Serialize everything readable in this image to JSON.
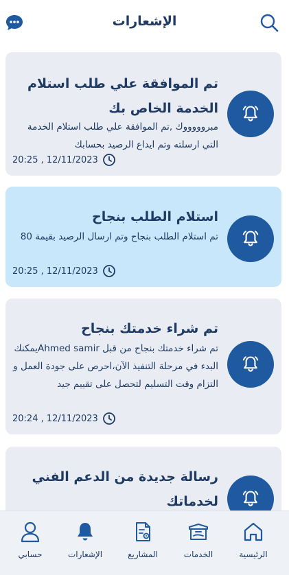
{
  "header": {
    "title": "الإشعارات",
    "search_icon": "search-icon",
    "chat_icon": "chat-icon"
  },
  "notifications": [
    {
      "title": "تم الموافقة علي طلب استلام الخدمة الخاص بك",
      "body": "مبروووووك ,تم الموافقة علي طلب استلام الخدمة التي ارسلته وتم ايداع الرصيد بحسابك",
      "time": "20:25 , 12/11/2023",
      "highlighted": false
    },
    {
      "title": "استلام الطلب بنجاح",
      "body": "تم استلام الطلب بنجاح وتم ارسال الرصيد بقيمة 80",
      "time": "20:25 , 12/11/2023",
      "highlighted": true
    },
    {
      "title": "تم شراء خدمتك بنجاح",
      "body": "تم شراء خدمتك بنجاح من قبل Ahmed samirيمكنك البدء في مرحلة التنفيذ الآن،احرص على جودة العمل و التزام وقت التسليم لتحصل على تقييم جيد",
      "time": "20:24 , 12/11/2023",
      "highlighted": false
    },
    {
      "title": "رسالة جديدة من الدعم الفني لخدماتك",
      "body": "",
      "time": "",
      "highlighted": false
    }
  ],
  "nav": [
    {
      "label": "الرئيسية",
      "icon": "home-icon"
    },
    {
      "label": "الخدمات",
      "icon": "services-box-icon"
    },
    {
      "label": "المشاريع",
      "icon": "projects-document-icon"
    },
    {
      "label": "الإشعارات",
      "icon": "notifications-bell-icon",
      "active": true
    },
    {
      "label": "حسابي",
      "icon": "profile-icon"
    }
  ],
  "colors": {
    "primary": "#1f5aa0",
    "text": "#1f3a63",
    "card": "#e9edf3",
    "card_highlight": "#c8e7fb"
  }
}
